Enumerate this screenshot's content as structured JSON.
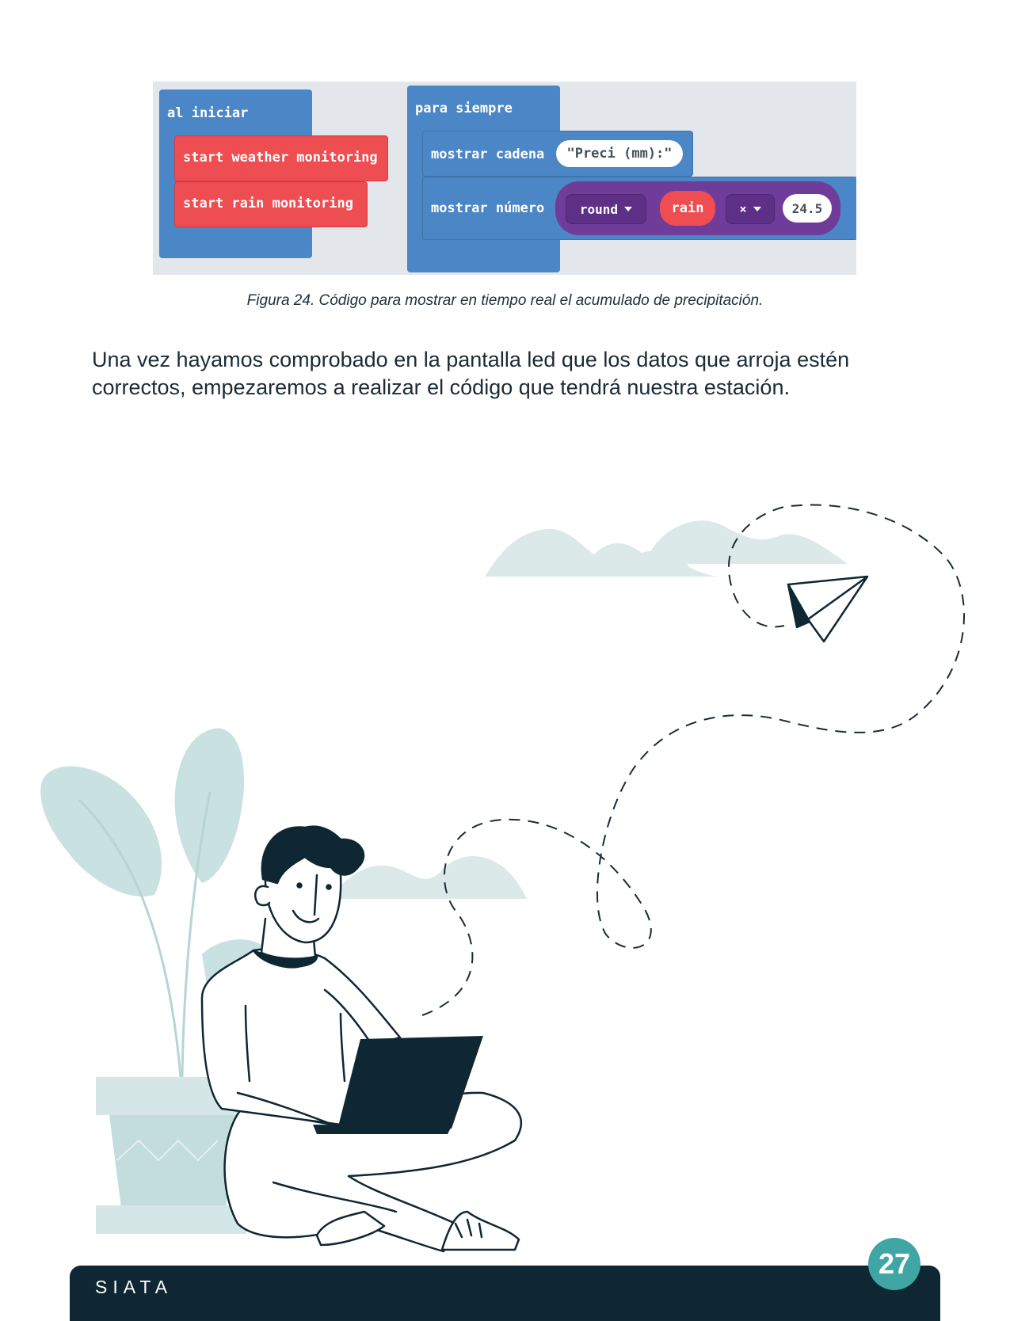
{
  "code": {
    "on_start_label": "al iniciar",
    "on_start_items": [
      "start weather monitoring",
      "start rain monitoring"
    ],
    "forever_label": "para siempre",
    "show_string_label": "mostrar cadena",
    "show_string_value": "\"Preci (mm):\"",
    "show_number_label": "mostrar número",
    "round_label": "round",
    "rain_label": "rain",
    "operator_label": "×",
    "number_value": "24.5"
  },
  "caption": "Figura 24. Código para mostrar en tiempo real el acumulado de precipitación.",
  "paragraph": {
    "line1": "Una vez hayamos comprobado en la pantalla led que los datos que arroja estén",
    "line2": "correctos, empezaremos a realizar el código que tendrá nuestra estación."
  },
  "footer": {
    "brand": "SIATA",
    "page_number": "27"
  },
  "colors": {
    "block_blue": "#4b86c6",
    "block_red": "#ee4d51",
    "block_purple": "#6f3c9a",
    "footer_navy": "#0f2733",
    "badge_teal": "#3fa6a4",
    "illustration_mint": "#c9e1e0"
  }
}
